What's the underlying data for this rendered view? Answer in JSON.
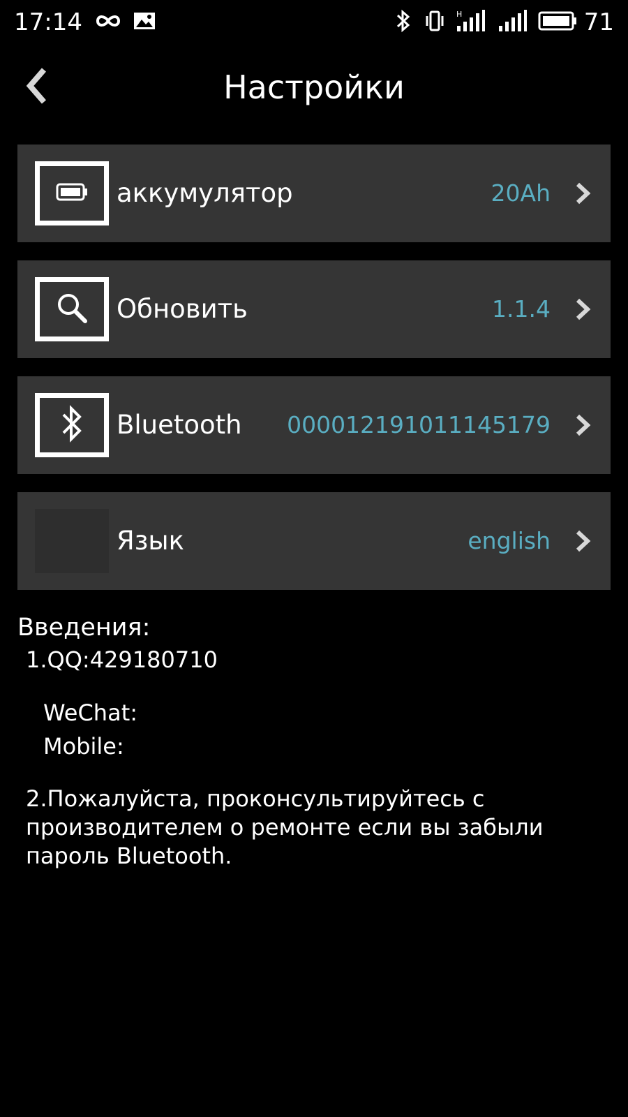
{
  "status_bar": {
    "time": "17:14",
    "battery_percent": "71",
    "left_icons": [
      "infinity-icon",
      "image-icon"
    ],
    "right_icons": [
      "bluetooth-icon",
      "vibrate-icon",
      "signal-h-icon",
      "signal-icon",
      "battery-icon"
    ]
  },
  "header": {
    "title": "Настройки",
    "back_icon": "chevron-left-icon"
  },
  "settings": [
    {
      "id": "battery",
      "icon": "battery-icon",
      "label": "аккумулятор",
      "value": "20Ah"
    },
    {
      "id": "update",
      "icon": "search-icon",
      "label": "Обновить",
      "value": "1.1.4"
    },
    {
      "id": "bluetooth",
      "icon": "bluetooth-icon",
      "label": "Bluetooth",
      "value": "000012191011145179"
    },
    {
      "id": "language",
      "icon": "",
      "label": "Язык",
      "value": "english"
    }
  ],
  "intro": {
    "title": "Введения:",
    "qq": "1.QQ:429180710",
    "wechat": "WeChat:",
    "mobile": "Mobile:",
    "note": "2.Пожалуйста, проконсультируйтесь с производителем о ремонте если вы забыли пароль Bluetooth."
  },
  "colors": {
    "background": "#000000",
    "row_background": "#353535",
    "value_accent": "#5aaec2",
    "text": "#ffffff"
  }
}
